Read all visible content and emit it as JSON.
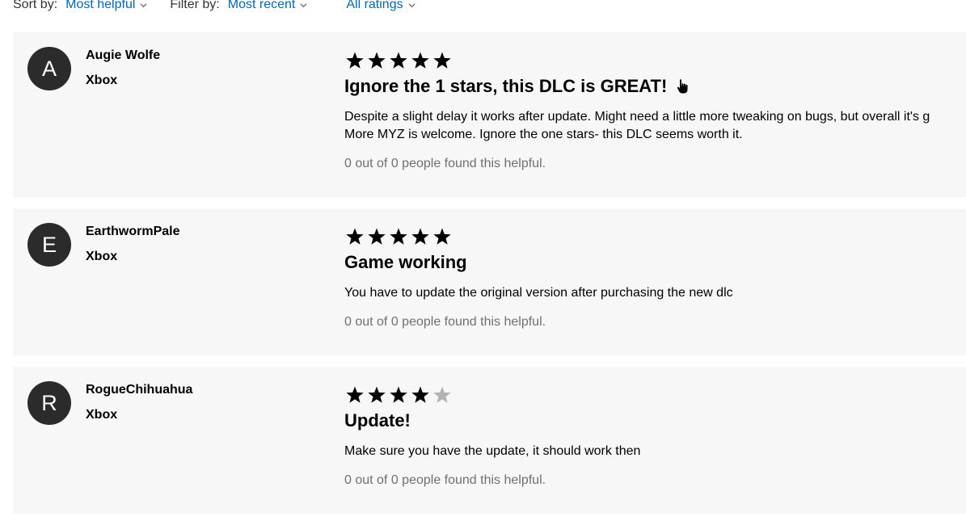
{
  "filters": {
    "sort_label": "Sort by:",
    "sort_value": "Most helpful",
    "filter_label": "Filter by:",
    "filter_value": "Most recent",
    "ratings_value": "All ratings"
  },
  "colors": {
    "link": "#0067b8",
    "card_bg": "#f7f7f7",
    "avatar_bg": "#2b2b2b",
    "star_filled": "#000000",
    "star_empty": "#b3b3b3"
  },
  "reviews": [
    {
      "initial": "A",
      "author": "Augie Wolfe",
      "platform": "Xbox",
      "rating": 5,
      "title": "Ignore the 1 stars, this DLC is GREAT!",
      "title_icon": "pointing-hand-icon",
      "body_line1": "Despite a slight delay it works after update. Might need a little more tweaking on bugs, but overall it's g",
      "body_line2": "More MYZ is welcome. Ignore the one stars- this DLC seems worth it.",
      "helpful": "0 out of 0 people found this helpful."
    },
    {
      "initial": "E",
      "author": "EarthwormPale",
      "platform": "Xbox",
      "rating": 5,
      "title": "Game working",
      "body_line1": "You have to update the original version after purchasing the new dlc",
      "helpful": "0 out of 0 people found this helpful."
    },
    {
      "initial": "R",
      "author": "RogueChihuahua",
      "platform": "Xbox",
      "rating": 4,
      "title": "Update!",
      "body_line1": "Make sure you have the update, it should work then",
      "helpful": "0 out of 0 people found this helpful."
    }
  ]
}
